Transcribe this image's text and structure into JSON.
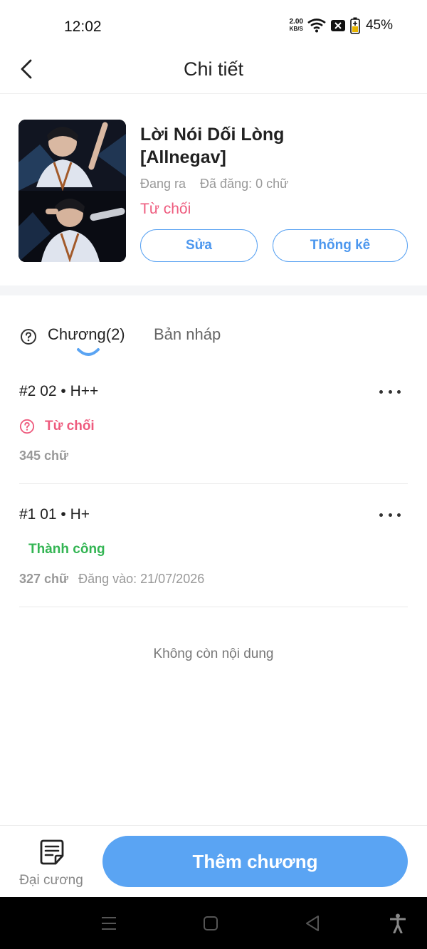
{
  "status_bar": {
    "time": "12:02",
    "net_speed": "2.00",
    "net_unit": "KB/S",
    "battery": "45%"
  },
  "header": {
    "title": "Chi tiết"
  },
  "book": {
    "title": "Lời Nói Dối Lòng [Allnegav]",
    "state": "Đang ra",
    "posted_words": "Đã đăng: 0 chữ",
    "review_status": "Từ chối",
    "edit_label": "Sửa",
    "stats_label": "Thống kê"
  },
  "tabs": {
    "chapters": "Chương(2)",
    "drafts": "Bản nháp"
  },
  "chapters": [
    {
      "title": "#2  02 • H++",
      "status": "Từ chối",
      "words": "345 chữ",
      "published": ""
    },
    {
      "title": "#1  01 • H+",
      "status": "Thành công",
      "words": "327 chữ",
      "published": "Đăng vào:  21/07/2026"
    }
  ],
  "end_message": "Không còn nội dung",
  "bottom": {
    "outline_label": "Đại cương",
    "add_chapter_label": "Thêm chương"
  },
  "colors": {
    "accent": "#5aa4f3",
    "rejected": "#ee5b7e",
    "success": "#33b553"
  }
}
